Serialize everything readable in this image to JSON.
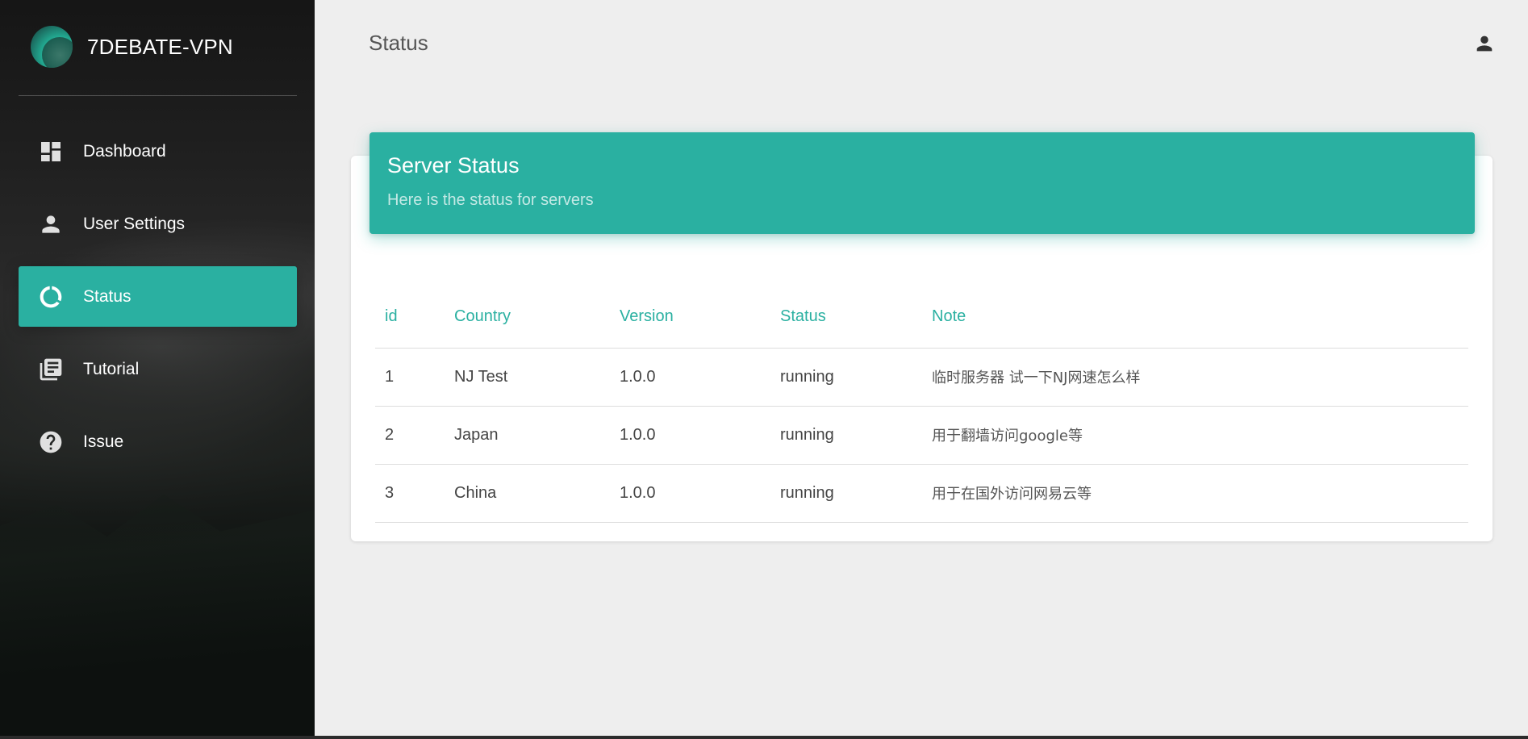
{
  "brand": {
    "title": "7DEBATE-VPN"
  },
  "sidebar": {
    "items": [
      {
        "label": "Dashboard",
        "icon": "dashboard-icon",
        "active": false
      },
      {
        "label": "User Settings",
        "icon": "person-icon",
        "active": false
      },
      {
        "label": "Status",
        "icon": "donut-icon",
        "active": true
      },
      {
        "label": "Tutorial",
        "icon": "library-books-icon",
        "active": false
      },
      {
        "label": "Issue",
        "icon": "help-circle-icon",
        "active": false
      }
    ]
  },
  "header": {
    "title": "Status",
    "account_icon": "person-icon"
  },
  "card": {
    "title": "Server Status",
    "subtitle": "Here is the status for servers"
  },
  "table": {
    "columns": [
      "id",
      "Country",
      "Version",
      "Status",
      "Note"
    ],
    "rows": [
      [
        "1",
        "NJ Test",
        "1.0.0",
        "running",
        "临时服务器 试一下NJ网速怎么样"
      ],
      [
        "2",
        "Japan",
        "1.0.0",
        "running",
        "用于翻墙访问google等"
      ],
      [
        "3",
        "China",
        "1.0.0",
        "running",
        "用于在国外访问网易云等"
      ]
    ]
  },
  "colors": {
    "accent": "#2ab0a1",
    "background": "#eeeeee"
  }
}
